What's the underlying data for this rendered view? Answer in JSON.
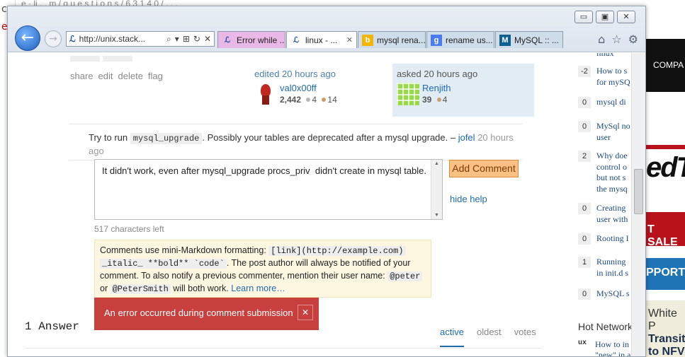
{
  "background": {
    "left_glyphs": [
      "c",
      "e"
    ],
    "top_strip": "e · li   . . m / q u e s t i o n s / 6 3 1 4 0 / . . .",
    "right_panel": {
      "dark_label": "COMPA",
      "logo": "edTC",
      "sale": "T SALE",
      "support": "PPORT",
      "nfv_white": "White P",
      "nfv_1": "Transit",
      "nfv_2": "to NFV"
    }
  },
  "window": {
    "buttons": {
      "minimize": "▭",
      "maximize": "▣",
      "close": "✕"
    },
    "back": "←",
    "forward": "→",
    "address": {
      "icon": "ℒ",
      "url": "http://unix.stack...",
      "search": "⌕",
      "dropdown": "▾",
      "compat": "⊞",
      "refresh": "↻",
      "stop": "✕"
    },
    "tabs": [
      {
        "icon": "ℒ",
        "label": "Error while ...",
        "close": ""
      },
      {
        "icon": "ℒ",
        "label": "linux - ...",
        "close": "✕"
      },
      {
        "icon": "b",
        "label": "mysql rena...",
        "close": ""
      },
      {
        "icon": "g",
        "label": "rename us...",
        "close": ""
      },
      {
        "icon": "M",
        "label": "MySQL :: ...",
        "close": ""
      }
    ],
    "tools": {
      "home": "⌂",
      "favorites": "☆",
      "settings": "⚙"
    }
  },
  "post": {
    "actions": [
      "share",
      "edit",
      "delete",
      "flag"
    ],
    "edited": {
      "action": "edited 20 hours ago",
      "name": "val0x00ff",
      "rep": "2,442",
      "silver": "4",
      "bronze": "14"
    },
    "asked": {
      "action": "asked 20 hours ago",
      "name": "Renjith",
      "rep": "39",
      "bronze": "4"
    }
  },
  "comment": {
    "before": "Try to run ",
    "code": "mysql_upgrade",
    "after": ". Possibly your tables are deprecated after a mysql upgrade. – ",
    "author": "jofel",
    "time": "20 hours ago"
  },
  "comment_form": {
    "text": "It didn't work, even after mysql_upgrade procs_priv  didn't create in mysql table.",
    "submit": "Add Comment",
    "hide_help": "hide help",
    "chars_left": "517 characters left",
    "scroll_up": "▲",
    "scroll_down": "▼"
  },
  "help": {
    "p1": "Comments use mini-Markdown formatting: ",
    "code1": "[link](http://example.com)",
    "code2": "_italic_ **bold** `code`",
    "p2": ". The post author will always be notified of your comment. To also notify a previous commenter, mention their user name: ",
    "code3": "@peter",
    "p3": " or ",
    "code4": "@PeterSmith",
    "p4": " will both work. ",
    "learn": "Learn more…"
  },
  "error": {
    "message": "An error occurred during comment submission",
    "close": "✕"
  },
  "answers": {
    "title": "1 Answer",
    "tabs": [
      "active",
      "oldest",
      "votes"
    ]
  },
  "related": [
    {
      "score": "",
      "lines": [
        "linux"
      ]
    },
    {
      "score": "-2",
      "lines": [
        "How to s",
        "for mySQ"
      ]
    },
    {
      "score": "0",
      "lines": [
        "mysql di"
      ]
    },
    {
      "score": "0",
      "lines": [
        "MySql no",
        "user"
      ]
    },
    {
      "score": "2",
      "lines": [
        "Why doe",
        "control o",
        "but not s",
        "the mysq"
      ]
    },
    {
      "score": "0",
      "lines": [
        "Creating",
        "user with"
      ]
    },
    {
      "score": "0",
      "lines": [
        "Rooting I"
      ]
    },
    {
      "score": "1",
      "lines": [
        "Running",
        "in init.d s"
      ]
    },
    {
      "score": "0",
      "lines": [
        "MySQL s"
      ]
    }
  ],
  "hot": {
    "title": "Hot Network",
    "item_icon": "ux",
    "item_lines": [
      "How to in",
      "\"new\" in a"
    ]
  }
}
